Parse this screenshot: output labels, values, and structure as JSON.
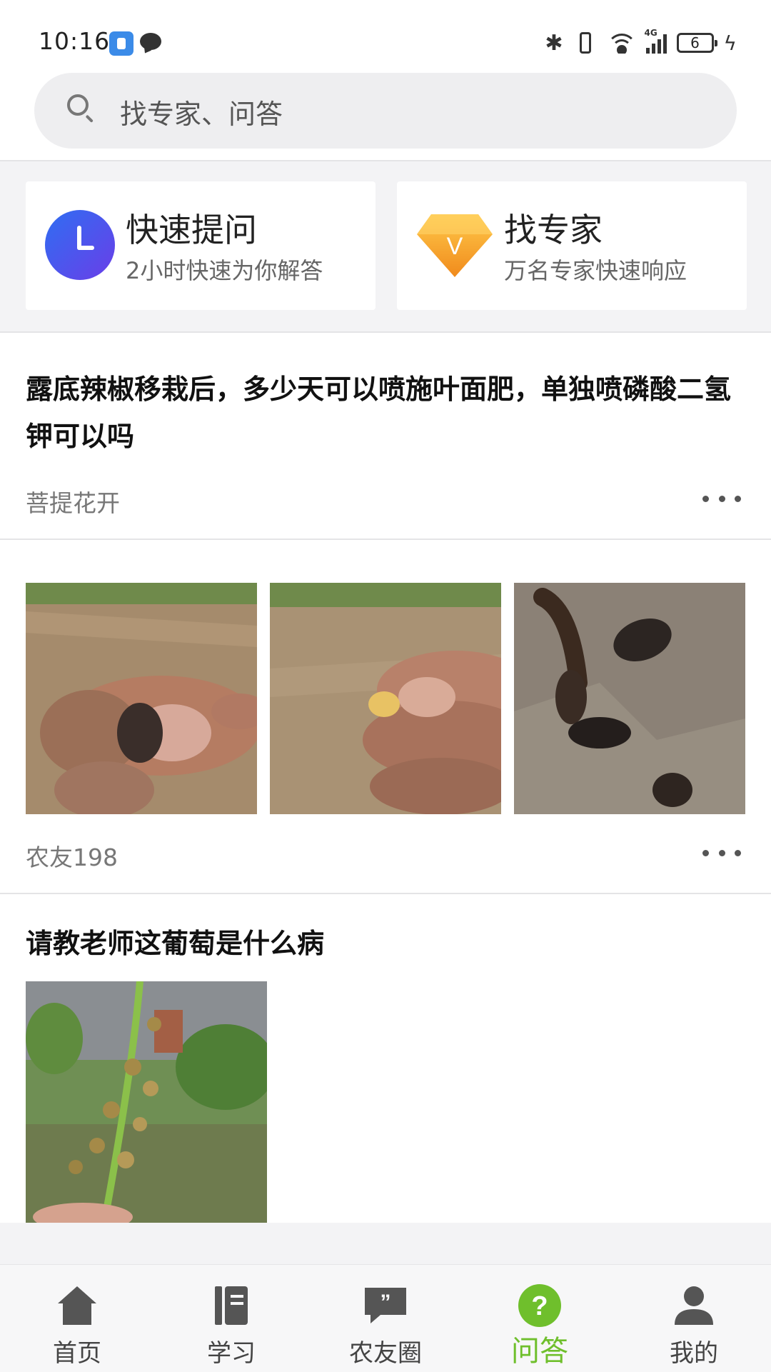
{
  "status_bar": {
    "time": "10:16",
    "battery": "6",
    "network": "4G"
  },
  "search": {
    "placeholder": "找专家、问答"
  },
  "quick_actions": [
    {
      "title": "快速提问",
      "subtitle": "2小时快速为你解答"
    },
    {
      "title": "找专家",
      "subtitle": "万名专家快速响应",
      "badge": "V"
    }
  ],
  "posts": [
    {
      "title": "露底辣椒移栽后，多少天可以喷施叶面肥，单独喷磷酸二氢钾可以吗",
      "author": "菩提花开"
    },
    {
      "author": "农友198",
      "images": [
        "soil-grub-in-hand-photo",
        "soil-larva-on-finger-photo",
        "pupae-on-plastic-photo"
      ]
    },
    {
      "title": "请教老师这葡萄是什么病",
      "images": [
        "grape-flower-cluster-photo"
      ]
    }
  ],
  "tabbar": {
    "items": [
      {
        "label": "首页",
        "icon": "home-icon"
      },
      {
        "label": "学习",
        "icon": "book-icon"
      },
      {
        "label": "农友圈",
        "icon": "quote-bubble-icon"
      },
      {
        "label": "问答",
        "icon": "question-icon"
      },
      {
        "label": "我的",
        "icon": "user-icon"
      }
    ],
    "active_index": 3,
    "active_color": "#6fbf2c"
  },
  "colors": {
    "accent_green": "#6fbf2c",
    "ask_blue": "#3f55ee",
    "expert_orange": "#f6a623"
  }
}
